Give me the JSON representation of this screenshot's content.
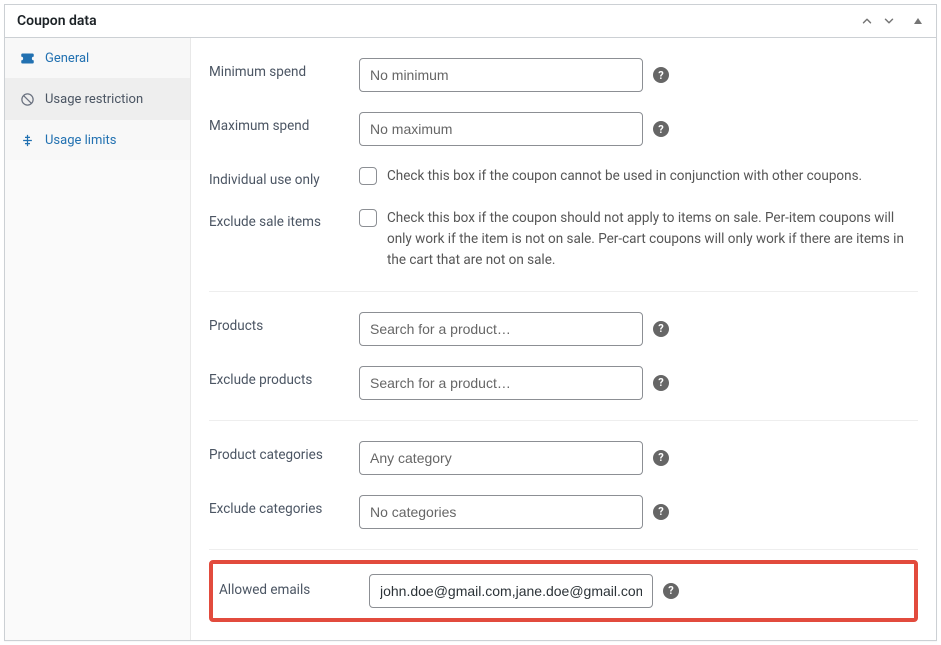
{
  "header": {
    "title": "Coupon data"
  },
  "tabs": {
    "general": {
      "label": "General"
    },
    "usage_restriction": {
      "label": "Usage restriction"
    },
    "usage_limits": {
      "label": "Usage limits"
    }
  },
  "fields": {
    "min_spend": {
      "label": "Minimum spend",
      "placeholder": "No minimum",
      "value": ""
    },
    "max_spend": {
      "label": "Maximum spend",
      "placeholder": "No maximum",
      "value": ""
    },
    "individual_use": {
      "label": "Individual use only",
      "desc": "Check this box if the coupon cannot be used in conjunction with other coupons."
    },
    "exclude_sale": {
      "label": "Exclude sale items",
      "desc": "Check this box if the coupon should not apply to items on sale. Per-item coupons will only work if the item is not on sale. Per-cart coupons will only work if there are items in the cart that are not on sale."
    },
    "products": {
      "label": "Products",
      "placeholder": "Search for a product…",
      "value": ""
    },
    "exclude_products": {
      "label": "Exclude products",
      "placeholder": "Search for a product…",
      "value": ""
    },
    "product_categories": {
      "label": "Product categories",
      "placeholder": "Any category",
      "value": ""
    },
    "exclude_categories": {
      "label": "Exclude categories",
      "placeholder": "No categories",
      "value": ""
    },
    "allowed_emails": {
      "label": "Allowed emails",
      "value": "john.doe@gmail.com,jane.doe@gmail.com"
    }
  },
  "help_glyph": "?"
}
